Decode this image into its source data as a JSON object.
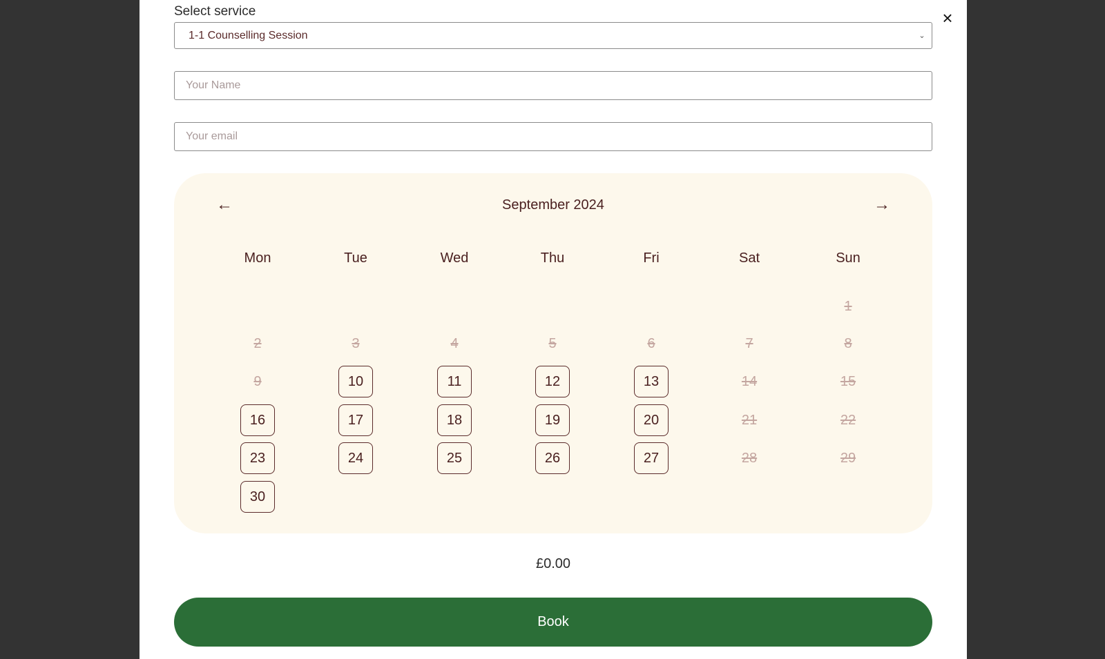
{
  "form": {
    "service_label": "Select service",
    "service_value": "1-1 Counselling Session",
    "name_placeholder": "Your Name",
    "email_placeholder": "Your email",
    "close_label": "×"
  },
  "calendar": {
    "month_label": "September 2024",
    "prev_label": "←",
    "next_label": "→",
    "weekdays": [
      "Mon",
      "Tue",
      "Wed",
      "Thu",
      "Fri",
      "Sat",
      "Sun"
    ],
    "first_weekday_index": 6,
    "days_in_month": 30,
    "available_days": [
      10,
      11,
      12,
      13,
      16,
      17,
      18,
      19,
      20,
      23,
      24,
      25,
      26,
      27,
      30
    ],
    "unavailable_days": [
      1,
      2,
      3,
      4,
      5,
      6,
      7,
      8,
      9,
      14,
      15,
      21,
      22,
      28,
      29
    ]
  },
  "summary": {
    "price": "£0.00",
    "book_label": "Book"
  },
  "colors": {
    "overlay": "#333333",
    "calendar_bg": "#fdf8ec",
    "text_brown": "#4a2020",
    "disabled_text": "#c4a6a0",
    "book_button": "#2b6e37"
  }
}
